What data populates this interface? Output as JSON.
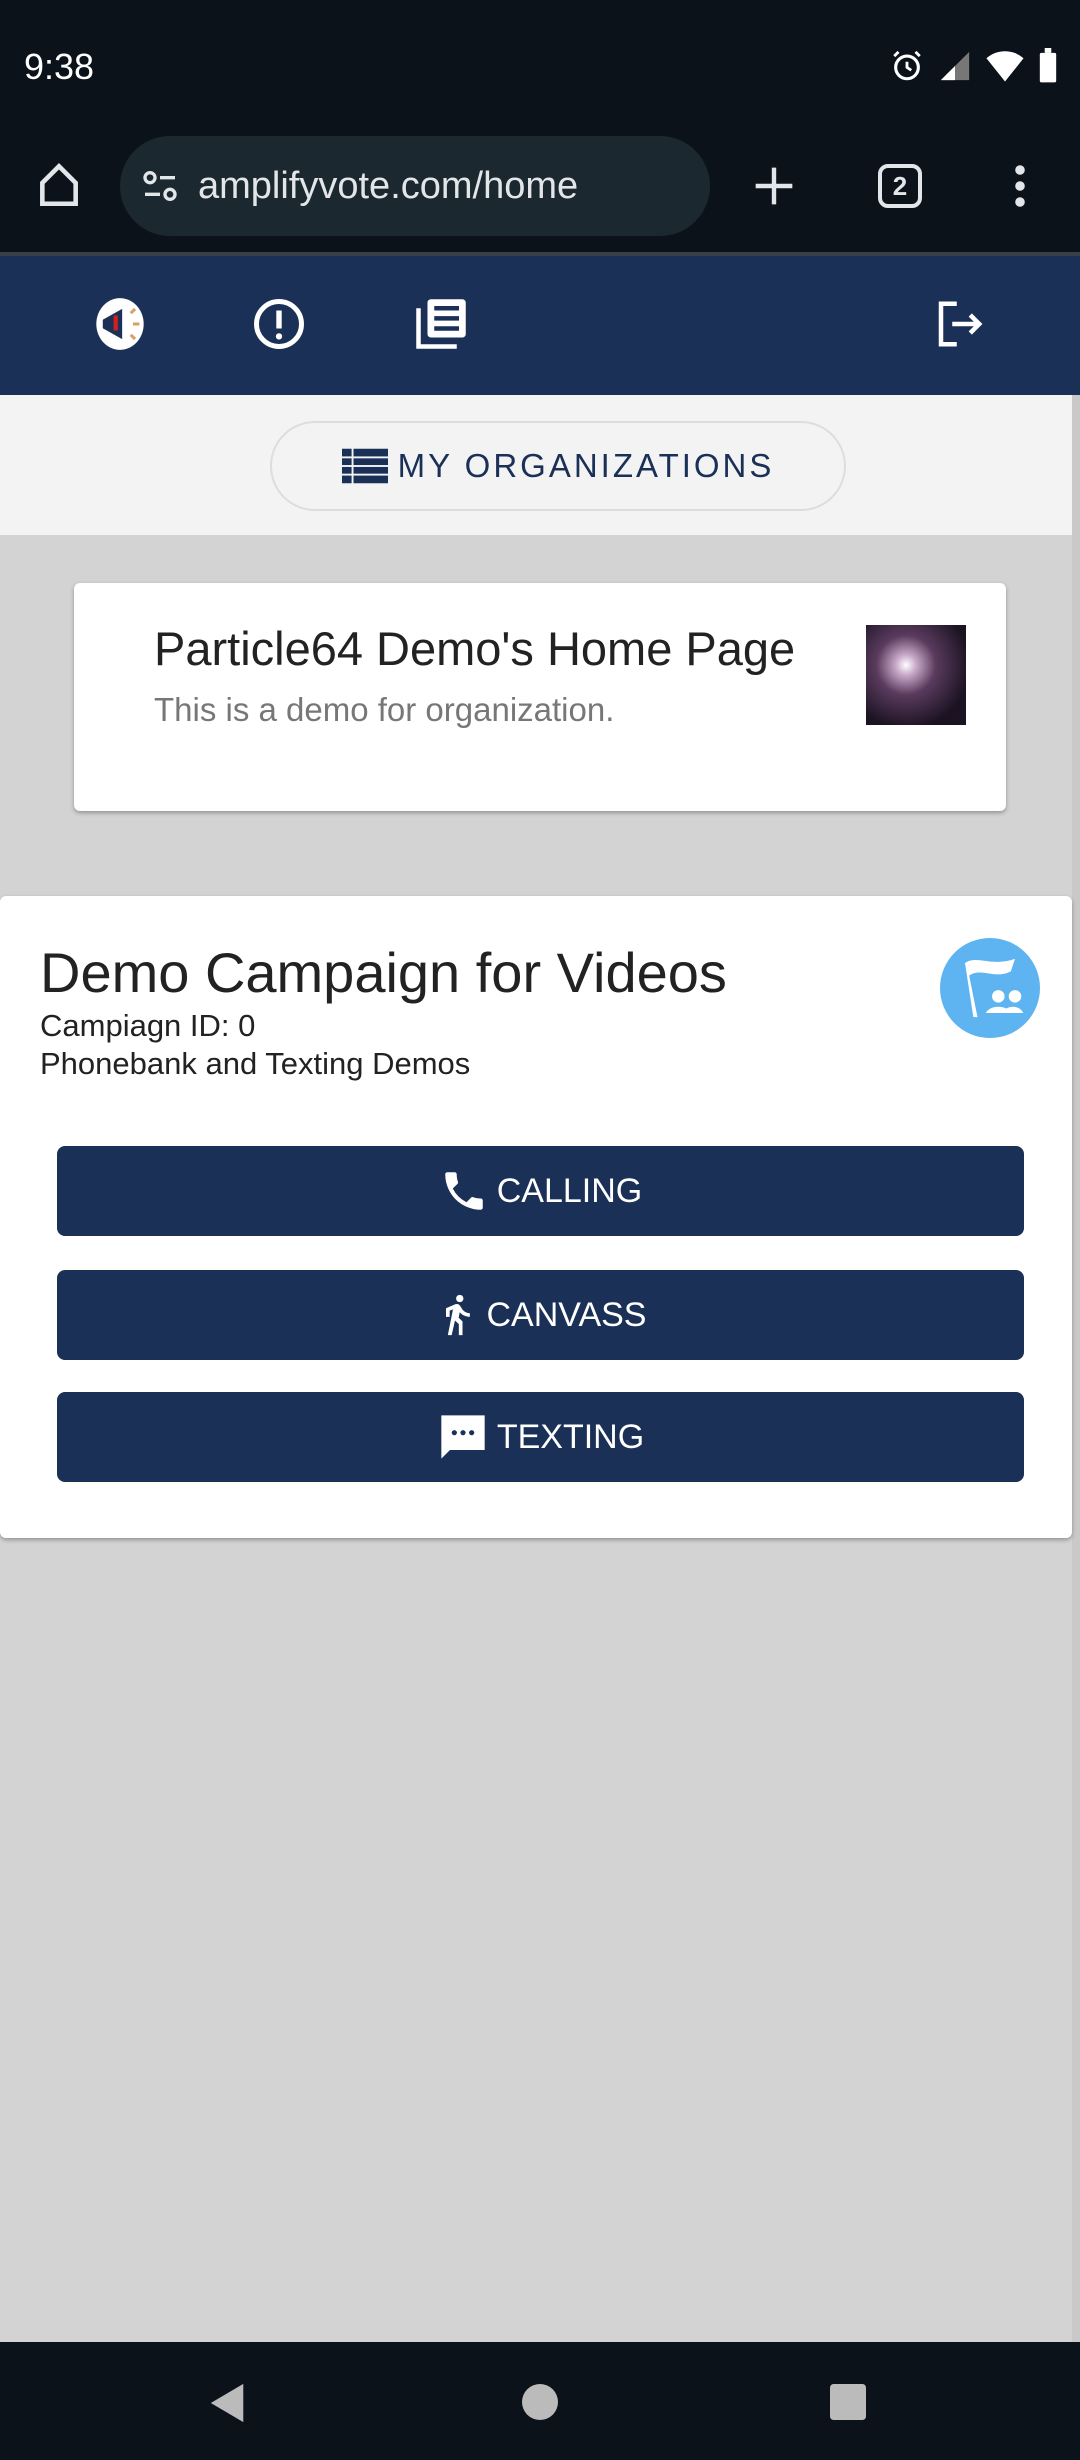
{
  "status_bar": {
    "time": "9:38",
    "icons": [
      "alarm-icon",
      "signal-icon",
      "wifi-icon",
      "battery-icon"
    ]
  },
  "browser": {
    "url": "amplifyvote.com/home",
    "tab_count": "2"
  },
  "nav": {
    "icons": [
      "megaphone-logo-icon",
      "alert-icon",
      "news-icon",
      "logout-icon"
    ]
  },
  "org_header": {
    "button_label": "MY ORGANIZATIONS"
  },
  "org_card": {
    "title": "Particle64 Demo's Home Page",
    "subtitle": "This is a demo for organization."
  },
  "campaign": {
    "title": "Demo Campaign for Videos",
    "id_line": "Campiagn ID: 0",
    "description": "Phonebank and Texting Demos",
    "buttons": [
      {
        "label": "CALLING",
        "icon": "phone-icon"
      },
      {
        "label": "CANVASS",
        "icon": "walk-icon"
      },
      {
        "label": "TEXTING",
        "icon": "sms-icon"
      }
    ]
  },
  "colors": {
    "navy": "#1a3057",
    "accent": "#5db4f0"
  }
}
